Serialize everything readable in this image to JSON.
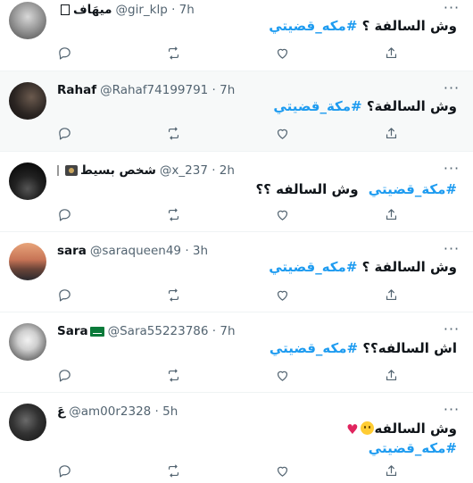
{
  "tweets": [
    {
      "name": "ميهَاف",
      "handle": "@gir_klp · 7h",
      "text": "وش السالفة ؟",
      "hashtag": "#مكه_قضيتي",
      "highlighted": false
    },
    {
      "name": "Rahaf",
      "handle": "@Rahaf74199791 · 7h",
      "text": "وش السالفة؟",
      "hashtag": "#مكة_قضيتي",
      "highlighted": true
    },
    {
      "name": "شخص بسيط",
      "handle": "@x_237 · 2h",
      "hashtag": "#مكة_قضيتي",
      "text": "وش السالفه ؟؟",
      "highlighted": false
    },
    {
      "name": "sara",
      "handle": "@saraqueen49 · 3h",
      "text": "وش السالفة ؟",
      "hashtag": "#مكه_قضيتي",
      "highlighted": false
    },
    {
      "name": "Sara",
      "handle": "@Sara55223786 · 7h",
      "text": "اش السالفه؟؟",
      "hashtag": "#مكه_قضيتي",
      "highlighted": false
    },
    {
      "name": "عَ",
      "handle": "@am00r2328 · 5h",
      "text": "وش السالفه",
      "hashtag": "#مكه_قضيتي",
      "highlighted": false
    }
  ],
  "icons": {
    "reply": "reply-icon",
    "retweet": "retweet-icon",
    "like": "like-icon",
    "share": "share-icon",
    "more": "more-icon"
  },
  "colors": {
    "hashtag": "#1d9bf0",
    "meta": "#536471",
    "highlight_bg": "#f7f9f9"
  }
}
